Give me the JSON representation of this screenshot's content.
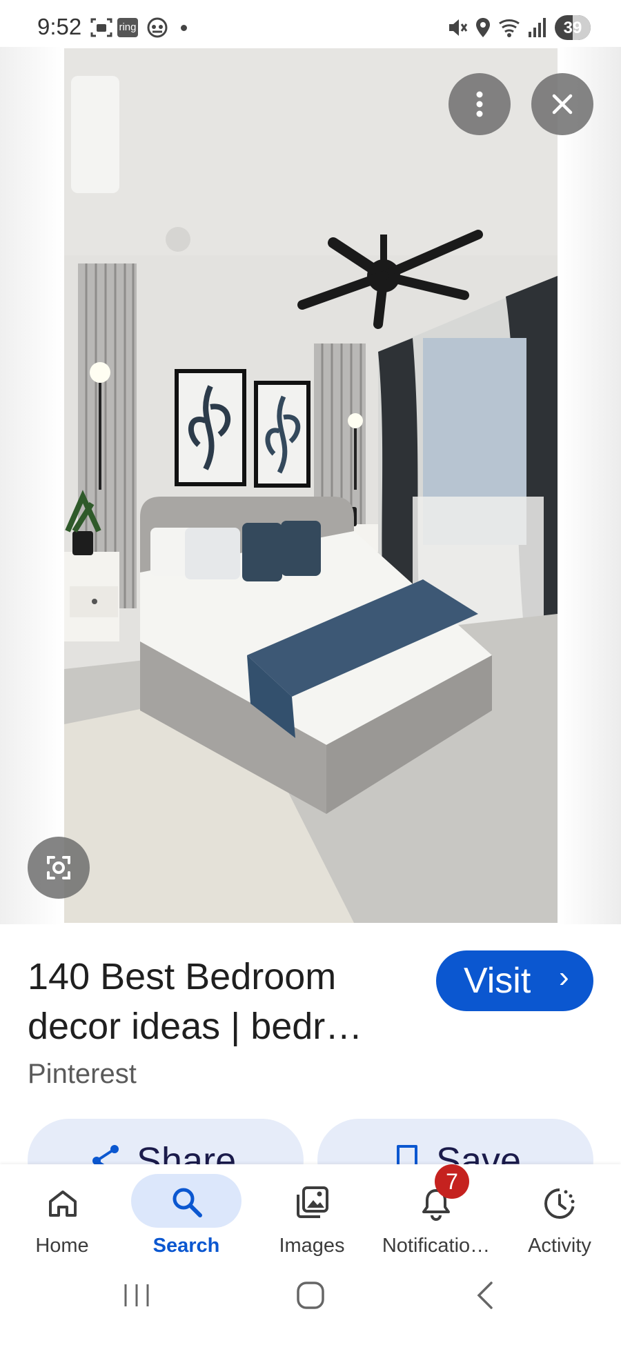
{
  "status_bar": {
    "time": "9:52",
    "ring_label": "ring",
    "battery": "39"
  },
  "image": {
    "alt": "Bedroom with ceiling fan, slatted wall panels, framed leaf prints and bed"
  },
  "result": {
    "title": "140 Best Bedroom decor ideas | bedr…",
    "source": "Pinterest",
    "visit_label": "Visit",
    "visit_chevron": "›"
  },
  "actions": {
    "share_label": "Share",
    "save_label": "Save"
  },
  "nav": {
    "items": [
      {
        "label": "Home",
        "icon": "home-icon"
      },
      {
        "label": "Search",
        "icon": "search-icon",
        "active": true
      },
      {
        "label": "Images",
        "icon": "images-icon"
      },
      {
        "label": "Notificatio…",
        "icon": "bell-icon",
        "badge": "7"
      },
      {
        "label": "Activity",
        "icon": "activity-icon"
      }
    ]
  },
  "colors": {
    "accent": "#0b57d0",
    "pill_bg": "#e6ecf9",
    "badge": "#c5221f"
  }
}
